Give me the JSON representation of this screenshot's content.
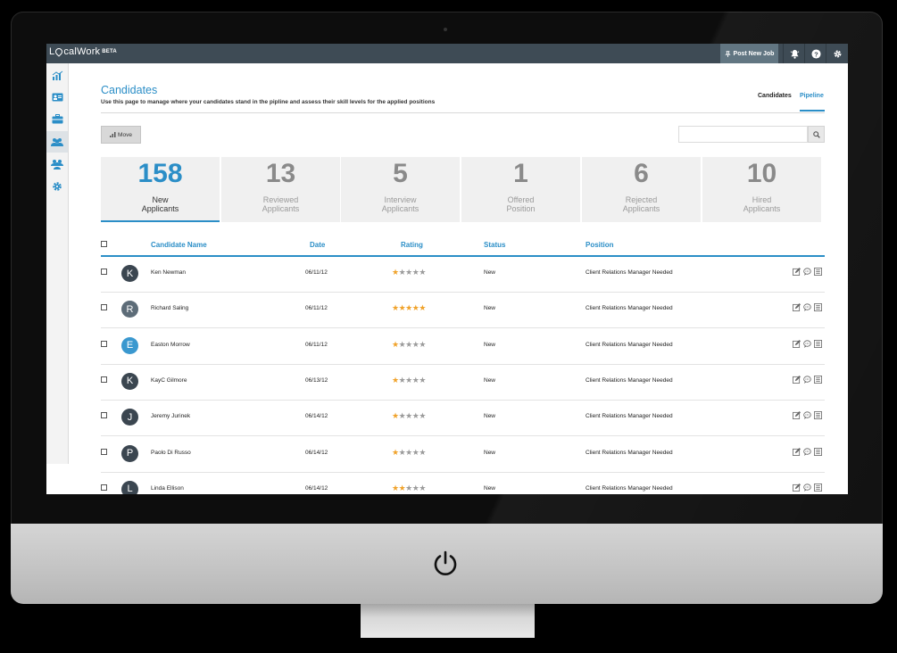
{
  "app": {
    "logo_text": "LocalWork",
    "logo_pre": "L",
    "logo_post": "calWork",
    "beta": "BETA",
    "post_job_label": "Post New Job"
  },
  "sidebar": {
    "items": [
      {
        "icon": "chart-icon"
      },
      {
        "icon": "id-card-icon"
      },
      {
        "icon": "briefcase-icon"
      },
      {
        "icon": "candidates-icon",
        "active": true
      },
      {
        "icon": "team-icon"
      },
      {
        "icon": "gear-icon"
      }
    ]
  },
  "header": {
    "title": "Candidates",
    "subtitle": "Use this page to manage where your candidates stand in the pipline and assess their skill levels for the applied positions",
    "nav": {
      "candidates": "Candidates",
      "pipeline": "Pipeline"
    }
  },
  "toolbar": {
    "move_label": "Move",
    "search_placeholder": "",
    "search_value": ""
  },
  "stats": [
    {
      "num": "158",
      "line1": "New",
      "line2": "Applicants",
      "active": true
    },
    {
      "num": "13",
      "line1": "Reviewed",
      "line2": "Applicants"
    },
    {
      "num": "5",
      "line1": "Interview",
      "line2": "Applicants"
    },
    {
      "num": "1",
      "line1": "Offered",
      "line2": "Position"
    },
    {
      "num": "6",
      "line1": "Rejected",
      "line2": "Applicants"
    },
    {
      "num": "10",
      "line1": "Hired",
      "line2": "Applicants"
    }
  ],
  "table": {
    "columns": {
      "name": "Candidate Name",
      "date": "Date",
      "rating": "Rating",
      "status": "Status",
      "position": "Position"
    },
    "rows": [
      {
        "initial": "K",
        "name": "Ken Newman",
        "date": "06/11/12",
        "rating": 1,
        "status": "New",
        "position": "Client Relations Manager Needed",
        "avatar_color": "#3b4650"
      },
      {
        "initial": "R",
        "name": "Richard Saling",
        "date": "06/11/12",
        "rating": 5,
        "status": "New",
        "position": "Client Relations Manager Needed",
        "avatar_color": "#5d6c78"
      },
      {
        "initial": "E",
        "name": "Easton Morrow",
        "date": "06/11/12",
        "rating": 1,
        "status": "New",
        "position": "Client Relations Manager Needed",
        "avatar_color": "#3a98cf"
      },
      {
        "initial": "K",
        "name": "KayC Gilmore",
        "date": "06/13/12",
        "rating": 1,
        "status": "New",
        "position": "Client Relations Manager Needed",
        "avatar_color": "#3b4650"
      },
      {
        "initial": "J",
        "name": "Jeremy Jurinek",
        "date": "06/14/12",
        "rating": 1,
        "status": "New",
        "position": "Client Relations Manager Needed",
        "avatar_color": "#3b4650"
      },
      {
        "initial": "P",
        "name": "Paolo Di Russo",
        "date": "06/14/12",
        "rating": 1,
        "status": "New",
        "position": "Client Relations Manager Needed",
        "avatar_color": "#3b4650"
      },
      {
        "initial": "L",
        "name": "Linda Ellison",
        "date": "06/14/12",
        "rating": 2,
        "status": "New",
        "position": "Client Relations Manager Needed",
        "avatar_color": "#3b4650"
      }
    ],
    "row_actions": [
      "edit-icon",
      "comment-icon",
      "notes-icon"
    ],
    "max_rating": 5
  },
  "colors": {
    "accent": "#2b8ec7",
    "topbar": "#3e4b55",
    "star_on": "#f0a22a",
    "star_off": "#9b9b9b"
  }
}
